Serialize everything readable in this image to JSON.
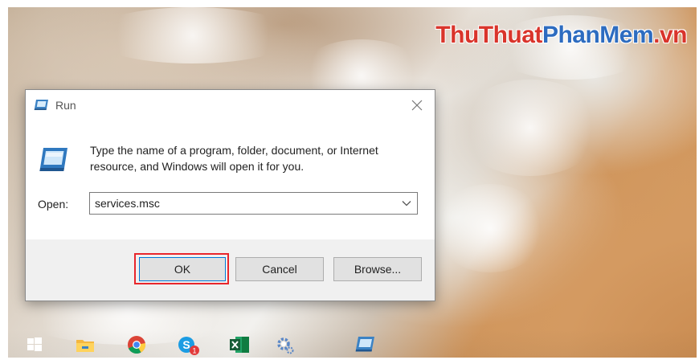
{
  "watermark": {
    "part1": "ThuThuat",
    "part2": "PhanMem",
    "part3": ".vn"
  },
  "dialog": {
    "title": "Run",
    "description": "Type the name of a program, folder, document, or Internet resource, and Windows will open it for you.",
    "open_label": "Open:",
    "open_value": "services.msc",
    "buttons": {
      "ok": "OK",
      "cancel": "Cancel",
      "browse": "Browse..."
    }
  },
  "taskbar": {
    "icons": [
      "windows-start-icon",
      "file-explorer-icon",
      "chrome-icon",
      "skype-icon",
      "excel-icon",
      "settings-icon",
      "run-icon"
    ],
    "skype_badge": "1"
  },
  "colors": {
    "highlight": "#e8262c",
    "accent": "#0078d7"
  }
}
